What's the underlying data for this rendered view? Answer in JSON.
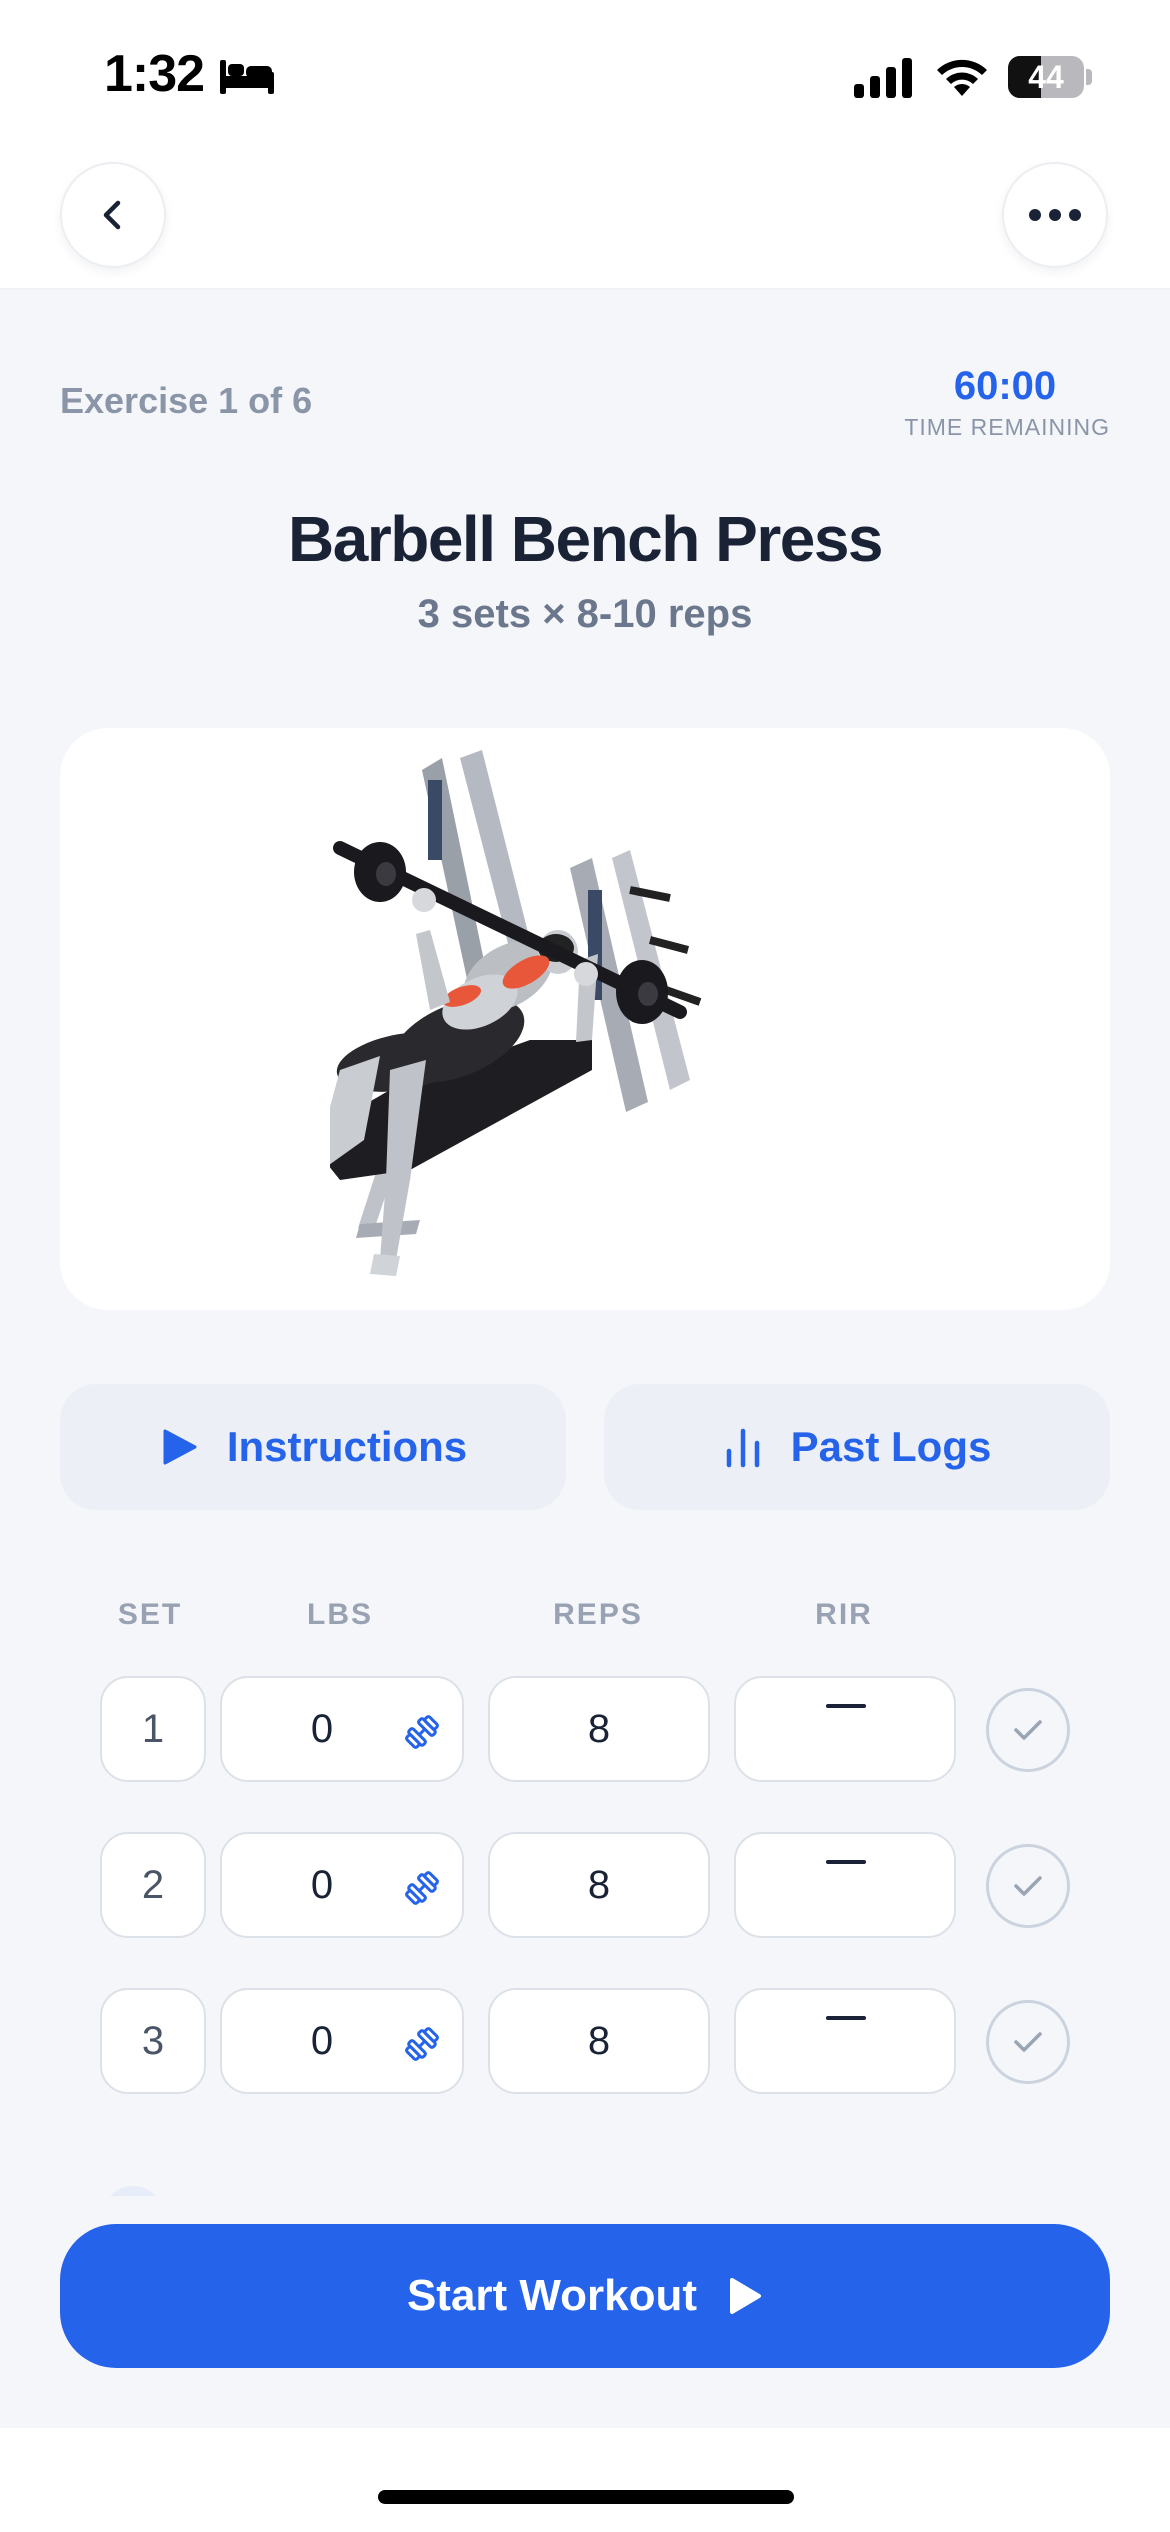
{
  "status_bar": {
    "time": "1:32",
    "battery_level": "44",
    "battery_fraction": 0.44,
    "icons": [
      "bed-icon",
      "signal-icon",
      "wifi-icon",
      "battery-icon"
    ]
  },
  "nav": {
    "back_icon": "chevron-left-icon",
    "more_icon": "ellipsis-icon"
  },
  "header": {
    "exercise_counter": "Exercise 1 of 6",
    "timer_value": "60:00",
    "timer_label": "TIME REMAINING"
  },
  "exercise": {
    "title": "Barbell Bench Press",
    "scheme": "3 sets × 8-10 reps",
    "image_icon": "bench-press-illustration"
  },
  "actions": {
    "instructions_label": "Instructions",
    "instructions_icon": "play-icon",
    "past_logs_label": "Past Logs",
    "past_logs_icon": "bar-chart-icon"
  },
  "sets_table": {
    "headers": {
      "set": "SET",
      "lbs": "LBS",
      "reps": "REPS",
      "rir": "RIR"
    },
    "rows": [
      {
        "set": "1",
        "lbs": "0",
        "reps": "8",
        "rir": ""
      },
      {
        "set": "2",
        "lbs": "0",
        "reps": "8",
        "rir": ""
      },
      {
        "set": "3",
        "lbs": "0",
        "reps": "8",
        "rir": ""
      }
    ]
  },
  "footer": {
    "start_label": "Start Workout",
    "start_icon": "play-icon"
  },
  "colors": {
    "accent": "#2563EB",
    "background": "#F4F6FA",
    "muted_text": "#8A95A8",
    "title_text": "#1A2236",
    "muscle_highlight": "#E8573A"
  }
}
